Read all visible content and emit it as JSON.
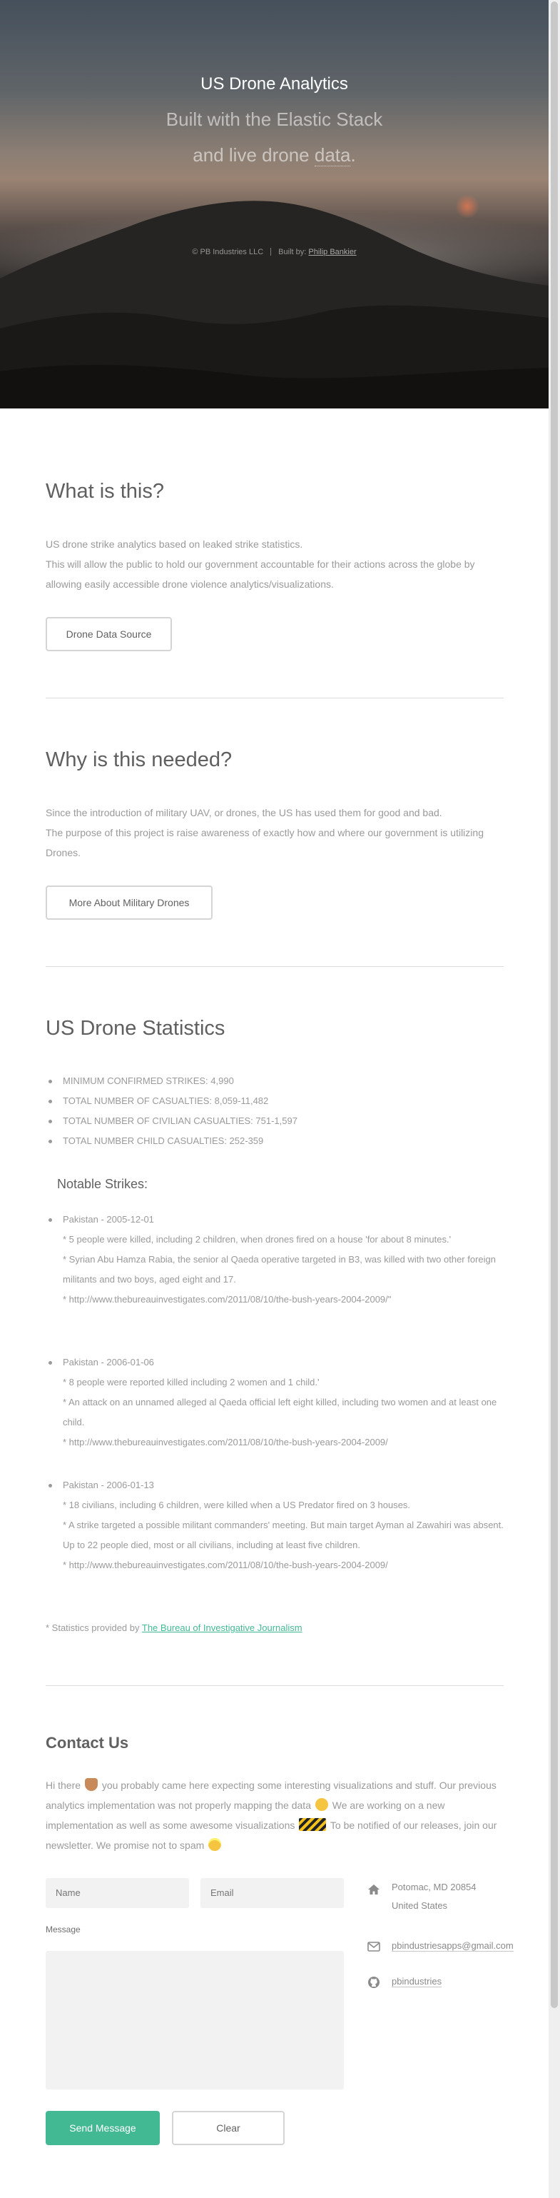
{
  "hero": {
    "title": "US Drone Analytics",
    "subtitle_line1": "Built with the Elastic Stack",
    "subtitle_line2_pre": "and live drone ",
    "subtitle_line2_word": "data",
    "subtitle_line2_post": ".",
    "copyright": "© PB Industries LLC",
    "built_by_label": "Built by:",
    "built_by_name": "Philip Bankier"
  },
  "what": {
    "title": "What is this?",
    "line1": "US drone strike analytics based on leaked strike statistics.",
    "line2": "This will allow the public to hold our government accountable for their actions across the globe by allowing easily accessible drone violence analytics/visualizations.",
    "button": "Drone Data Source"
  },
  "why": {
    "title": "Why is this needed?",
    "line1": "Since the introduction of military UAV, or drones, the US has used them for good and bad.",
    "line2": "The purpose of this project is raise awareness of exactly how and where our government is utilizing Drones.",
    "button": "More About Military Drones"
  },
  "stats": {
    "title": "US Drone Statistics",
    "items": [
      "MINIMUM CONFIRMED STRIKES: 4,990",
      "TOTAL NUMBER OF CASUALTIES: 8,059-11,482",
      "TOTAL NUMBER OF CIVILIAN CASUALTIES: 751-1,597",
      "TOTAL NUMBER CHILD CASUALTIES: 252-359"
    ],
    "notable_title": "Notable Strikes:",
    "strikes": [
      {
        "head": "Pakistan - 2005-12-01",
        "lines": [
          "* 5 people were killed, including 2 children, when drones fired on a house 'for about 8 minutes.'",
          "* Syrian Abu Hamza Rabia, the senior al Qaeda operative targeted in B3, was killed with two other foreign militants and two boys, aged eight and 17.",
          "* http://www.thebureauinvestigates.com/2011/08/10/the-bush-years-2004-2009/\""
        ]
      },
      {
        "head": "Pakistan - 2006-01-06",
        "lines": [
          "* 8 people were reported killed including 2 women and 1 child.'",
          "* An attack on an unnamed alleged al Qaeda official left eight killed, including two women and at least one child.",
          "* http://www.thebureauinvestigates.com/2011/08/10/the-bush-years-2004-2009/"
        ]
      },
      {
        "head": "Pakistan - 2006-01-13",
        "lines": [
          "* 18 civilians, including 6 children, were killed when a US Predator fired on 3 houses.",
          "* A strike targeted a possible militant commanders' meeting. But main target Ayman al Zawahiri was absent. Up to 22 people died, most or all civilians, including at least five children.",
          "* http://www.thebureauinvestigates.com/2011/08/10/the-bush-years-2004-2009/"
        ]
      }
    ],
    "credit_prefix": "* Statistics provided by ",
    "credit_link": "The Bureau of Investigative Journalism"
  },
  "contact": {
    "title": "Contact Us",
    "text_1": "Hi there",
    "text_2": "you probably came here expecting some interesting visualizations and stuff. Our previous analytics implementation was not properly mapping the data",
    "text_3": "We are working on a new implementation as well as some awesome visualizations",
    "text_4": "To be notified of our releases, join our newsletter. We promise not to spam",
    "name_placeholder": "Name",
    "email_placeholder": "Email",
    "message_label": "Message",
    "send": "Send Message",
    "clear": "Clear",
    "address_line1": "Potomac, MD 20854",
    "address_line2": "United States",
    "email": "pbindustriesapps@gmail.com",
    "github": "pbindustries"
  },
  "icons": {
    "address": "home-icon",
    "email": "envelope-icon",
    "github": "github-icon"
  },
  "colors": {
    "accent": "#43b993"
  }
}
